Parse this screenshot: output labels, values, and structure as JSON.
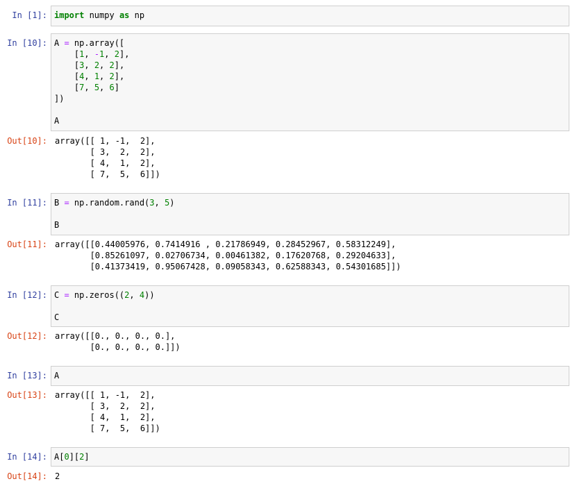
{
  "cells": [
    {
      "in_prompt": "In [1]:",
      "code": [
        [
          {
            "t": "import",
            "c": "kw"
          },
          {
            "t": " numpy "
          },
          {
            "t": "as",
            "c": "kw"
          },
          {
            "t": " np"
          }
        ]
      ]
    },
    {
      "in_prompt": "In [10]:",
      "code": [
        [
          {
            "t": "A "
          },
          {
            "t": "=",
            "c": "op"
          },
          {
            "t": " np.array(["
          }
        ],
        [
          {
            "t": "    ["
          },
          {
            "t": "1",
            "c": "num"
          },
          {
            "t": ", "
          },
          {
            "t": "-",
            "c": "op"
          },
          {
            "t": "1",
            "c": "num"
          },
          {
            "t": ", "
          },
          {
            "t": "2",
            "c": "num"
          },
          {
            "t": "],"
          }
        ],
        [
          {
            "t": "    ["
          },
          {
            "t": "3",
            "c": "num"
          },
          {
            "t": ", "
          },
          {
            "t": "2",
            "c": "num"
          },
          {
            "t": ", "
          },
          {
            "t": "2",
            "c": "num"
          },
          {
            "t": "],"
          }
        ],
        [
          {
            "t": "    ["
          },
          {
            "t": "4",
            "c": "num"
          },
          {
            "t": ", "
          },
          {
            "t": "1",
            "c": "num"
          },
          {
            "t": ", "
          },
          {
            "t": "2",
            "c": "num"
          },
          {
            "t": "],"
          }
        ],
        [
          {
            "t": "    ["
          },
          {
            "t": "7",
            "c": "num"
          },
          {
            "t": ", "
          },
          {
            "t": "5",
            "c": "num"
          },
          {
            "t": ", "
          },
          {
            "t": "6",
            "c": "num"
          },
          {
            "t": "]"
          }
        ],
        [
          {
            "t": "])"
          }
        ],
        [],
        [
          {
            "t": "A"
          }
        ]
      ],
      "out_prompt": "Out[10]:",
      "output": "array([[ 1, -1,  2],\n       [ 3,  2,  2],\n       [ 4,  1,  2],\n       [ 7,  5,  6]])"
    },
    {
      "in_prompt": "In [11]:",
      "code": [
        [
          {
            "t": "B "
          },
          {
            "t": "=",
            "c": "op"
          },
          {
            "t": " np.random.rand("
          },
          {
            "t": "3",
            "c": "num"
          },
          {
            "t": ", "
          },
          {
            "t": "5",
            "c": "num"
          },
          {
            "t": ")"
          }
        ],
        [],
        [
          {
            "t": "B"
          }
        ]
      ],
      "out_prompt": "Out[11]:",
      "output": "array([[0.44005976, 0.7414916 , 0.21786949, 0.28452967, 0.58312249],\n       [0.85261097, 0.02706734, 0.00461382, 0.17620768, 0.29204633],\n       [0.41373419, 0.95067428, 0.09058343, 0.62588343, 0.54301685]])"
    },
    {
      "in_prompt": "In [12]:",
      "code": [
        [
          {
            "t": "C "
          },
          {
            "t": "=",
            "c": "op"
          },
          {
            "t": " np.zeros(("
          },
          {
            "t": "2",
            "c": "num"
          },
          {
            "t": ", "
          },
          {
            "t": "4",
            "c": "num"
          },
          {
            "t": "))"
          }
        ],
        [],
        [
          {
            "t": "C"
          }
        ]
      ],
      "out_prompt": "Out[12]:",
      "output": "array([[0., 0., 0., 0.],\n       [0., 0., 0., 0.]])"
    },
    {
      "in_prompt": "In [13]:",
      "code": [
        [
          {
            "t": "A"
          }
        ]
      ],
      "out_prompt": "Out[13]:",
      "output": "array([[ 1, -1,  2],\n       [ 3,  2,  2],\n       [ 4,  1,  2],\n       [ 7,  5,  6]])"
    },
    {
      "in_prompt": "In [14]:",
      "code": [
        [
          {
            "t": "A["
          },
          {
            "t": "0",
            "c": "num"
          },
          {
            "t": "]["
          },
          {
            "t": "2",
            "c": "num"
          },
          {
            "t": "]"
          }
        ]
      ],
      "out_prompt": "Out[14]:",
      "output": "2"
    }
  ]
}
